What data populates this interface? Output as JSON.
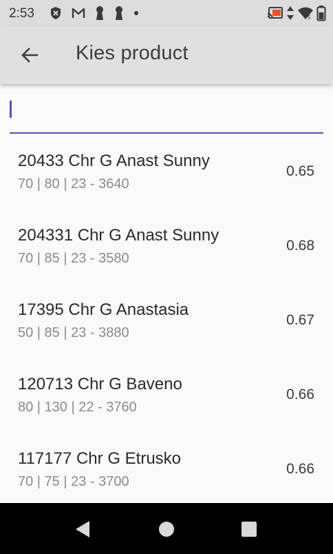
{
  "status_bar": {
    "time": "2:53",
    "icons_left": [
      "shield-icon",
      "gmail-icon",
      "keyhole-icon",
      "keyhole-icon",
      "dot-icon"
    ],
    "icons_right": [
      "cast-icon",
      "data-arrows-icon",
      "wifi-icon",
      "battery-icon"
    ]
  },
  "app_bar": {
    "back_icon": "arrow-left-icon",
    "title": "Kies product"
  },
  "search": {
    "value": "",
    "placeholder": ""
  },
  "products": [
    {
      "title": "20433 Chr G Anast Sunny",
      "subtitle": "70 | 80 | 23 - 3640",
      "value": "0.65"
    },
    {
      "title": "204331 Chr G Anast Sunny",
      "subtitle": "70 | 85 | 23 - 3580",
      "value": "0.68"
    },
    {
      "title": "17395 Chr G Anastasia",
      "subtitle": "50 | 85 | 23 - 3880",
      "value": "0.67"
    },
    {
      "title": "120713 Chr G Baveno",
      "subtitle": "80 | 130 | 22 - 3760",
      "value": "0.66"
    },
    {
      "title": "117177 Chr G Etrusko",
      "subtitle": "70 | 75 | 23 - 3700",
      "value": "0.66"
    }
  ],
  "nav_bar": {
    "icons": [
      "back-triangle-icon",
      "home-circle-icon",
      "recents-square-icon"
    ]
  },
  "colors": {
    "accent": "#6a45b8",
    "app_bar": "#e0e0e0",
    "status_bar": "#dcdcdc",
    "background": "#fafafa",
    "cast_accent": "#e8542a"
  }
}
